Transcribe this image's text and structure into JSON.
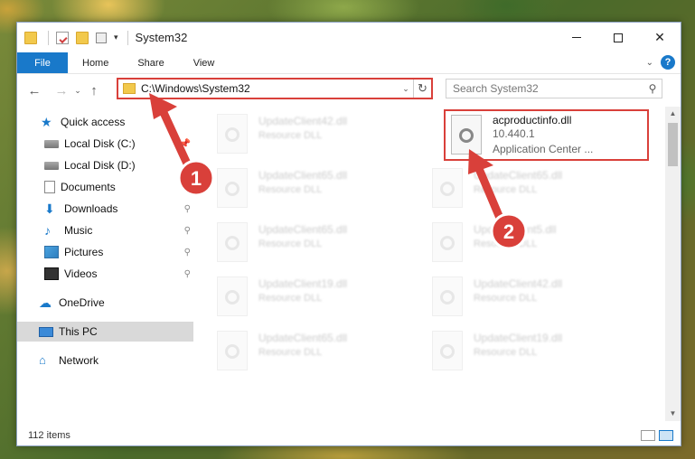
{
  "window": {
    "title": "System32"
  },
  "ribbon": {
    "tabs": [
      {
        "label": "File"
      },
      {
        "label": "Home"
      },
      {
        "label": "Share"
      },
      {
        "label": "View"
      }
    ],
    "help_label": "?"
  },
  "nav": {
    "address": "C:\\Windows\\System32",
    "search_placeholder": "Search System32"
  },
  "sidebar": {
    "items": [
      {
        "label": "Quick access",
        "icon": "star-icon"
      },
      {
        "label": "Local Disk (C:)",
        "icon": "disk-icon"
      },
      {
        "label": "Local Disk (D:)",
        "icon": "disk-icon"
      },
      {
        "label": "Documents",
        "icon": "documents-icon"
      },
      {
        "label": "Downloads",
        "icon": "download-icon"
      },
      {
        "label": "Music",
        "icon": "music-icon"
      },
      {
        "label": "Pictures",
        "icon": "pictures-icon"
      },
      {
        "label": "Videos",
        "icon": "videos-icon"
      },
      {
        "label": "OneDrive",
        "icon": "cloud-icon"
      },
      {
        "label": "This PC",
        "icon": "pc-icon"
      },
      {
        "label": "Network",
        "icon": "network-icon"
      }
    ]
  },
  "files": {
    "left": [
      {
        "name": "UpdateClient42.dll",
        "type": "Resource DLL"
      },
      {
        "name": "UpdateClient65.dll",
        "type": "Resource DLL"
      },
      {
        "name": "UpdateClient65.dll",
        "type": "Resource DLL"
      },
      {
        "name": "UpdateClient19.dll",
        "type": "Resource DLL"
      },
      {
        "name": "UpdateClient65.dll",
        "type": "Resource DLL"
      }
    ],
    "right": [
      {
        "name": "UpdateClient65.dll",
        "type": "Resource DLL"
      },
      {
        "name": "UpdateClient5.dll",
        "type": "Resource DLL"
      },
      {
        "name": "UpdateClient42.dll",
        "type": "Resource DLL"
      },
      {
        "name": "UpdateClient19.dll",
        "type": "Resource DLL"
      }
    ],
    "highlighted": {
      "name": "acproductinfo.dll",
      "version": "10.440.1",
      "description": "Application Center ..."
    }
  },
  "status": {
    "item_count": "112 items"
  },
  "annotations": {
    "step1": "1",
    "step2": "2",
    "color": "#d9403a"
  }
}
